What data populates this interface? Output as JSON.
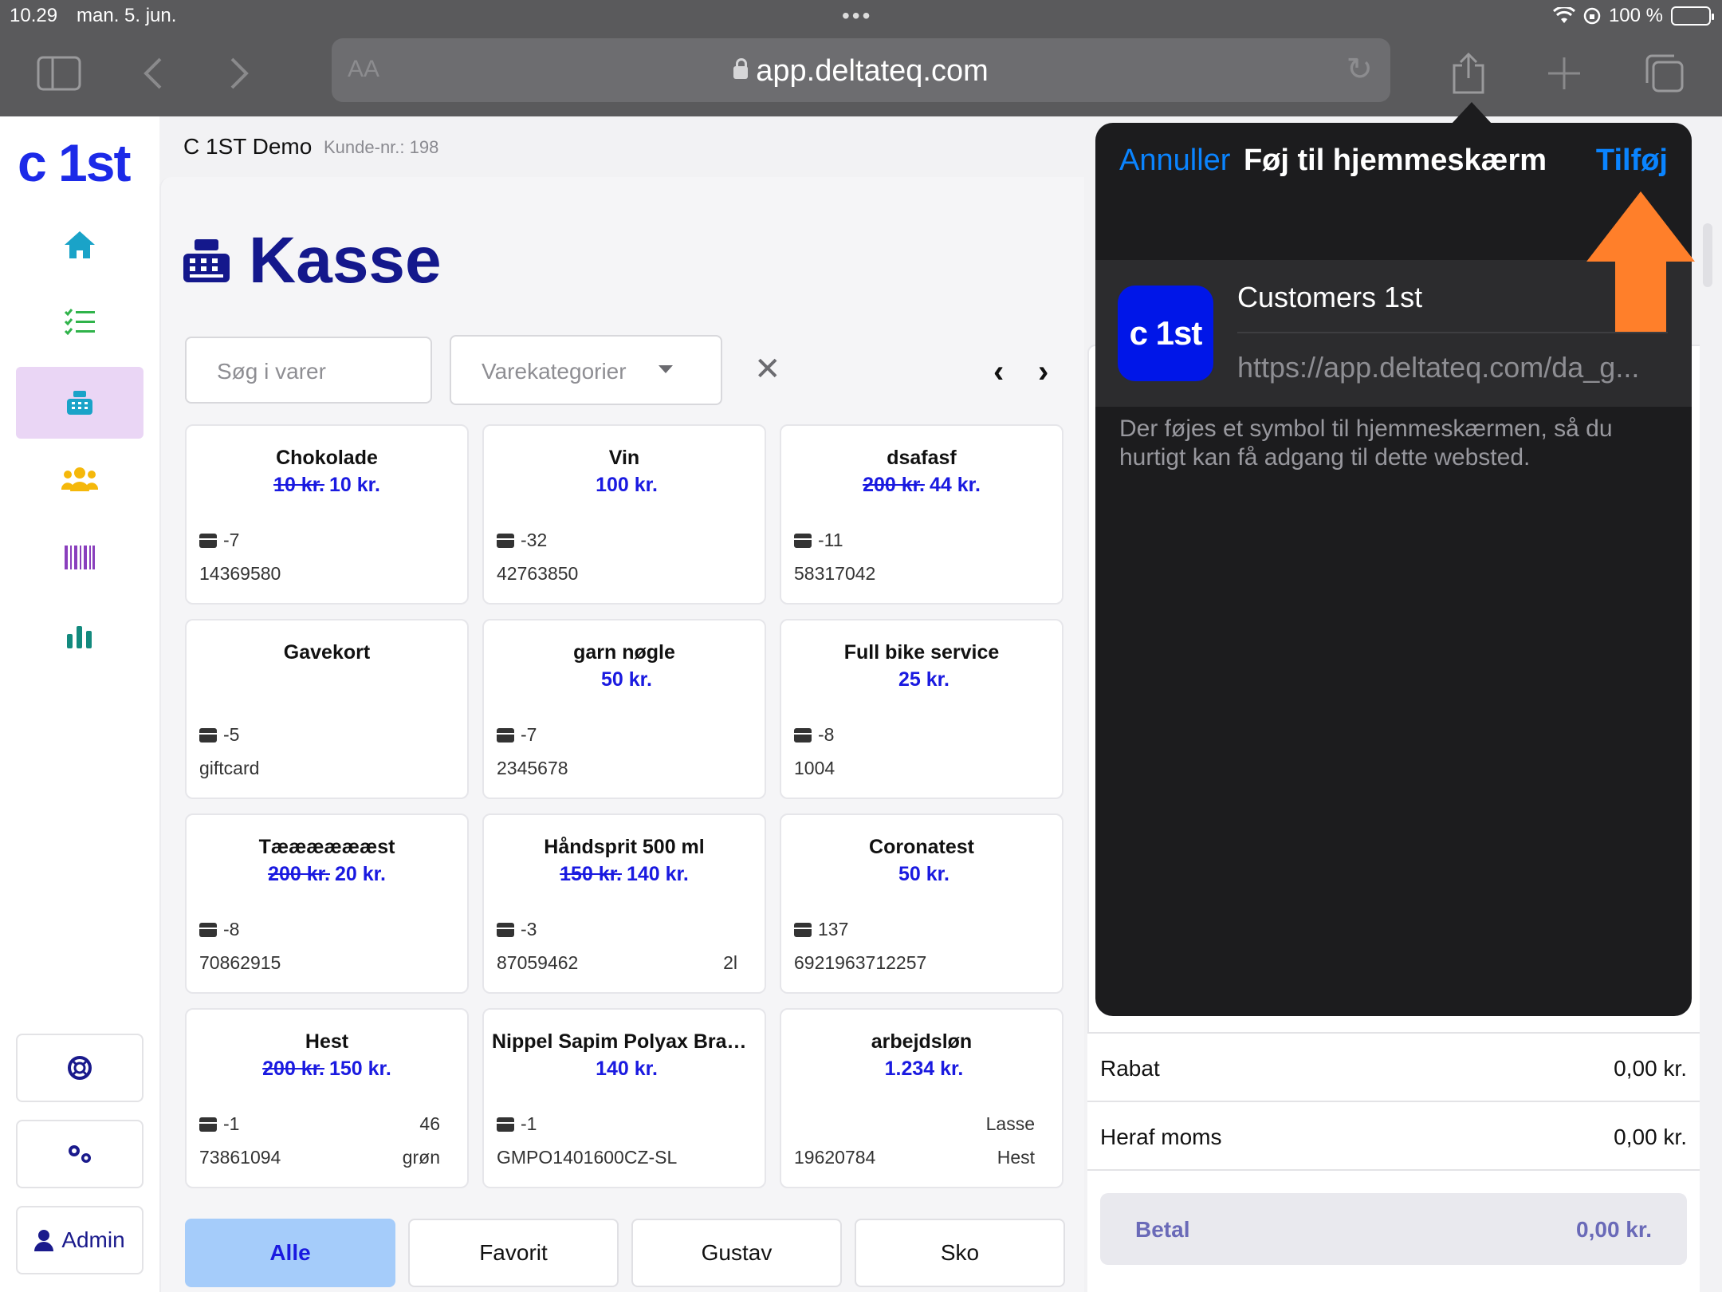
{
  "status": {
    "time": "10.29",
    "date": "man. 5. jun.",
    "battery": "100 %"
  },
  "browser": {
    "url": "app.deltateq.com",
    "aa_label": "AA"
  },
  "app": {
    "logo": "c 1st",
    "company": "C 1ST Demo",
    "customer_no": "Kunde-nr.: 198",
    "nav": [
      "home-icon",
      "checklist-icon",
      "register-icon",
      "users-icon",
      "barcode-icon",
      "chart-icon"
    ],
    "admin_label": "Admin"
  },
  "page": {
    "title": "Kasse",
    "search_placeholder": "Søg i varer",
    "category_placeholder": "Varekategorier"
  },
  "products": [
    {
      "name": "Chokolade",
      "old_price": "10 kr.",
      "price": "10 kr.",
      "stock": "-7",
      "sku": "14369580",
      "extra1": "",
      "extra2": ""
    },
    {
      "name": "Vin",
      "old_price": "",
      "price": "100 kr.",
      "stock": "-32",
      "sku": "42763850",
      "extra1": "",
      "extra2": ""
    },
    {
      "name": "dsafasf",
      "old_price": "200 kr.",
      "price": "44 kr.",
      "stock": "-11",
      "sku": "58317042",
      "extra1": "",
      "extra2": ""
    },
    {
      "name": "Gavekort",
      "old_price": "",
      "price": "",
      "stock": "-5",
      "sku": "giftcard",
      "extra1": "",
      "extra2": ""
    },
    {
      "name": "garn nøgle",
      "old_price": "",
      "price": "50 kr.",
      "stock": "-7",
      "sku": "2345678",
      "extra1": "",
      "extra2": ""
    },
    {
      "name": "Full bike service",
      "old_price": "",
      "price": "25 kr.",
      "stock": "-8",
      "sku": "1004",
      "extra1": "",
      "extra2": ""
    },
    {
      "name": "Tææææææst",
      "old_price": "200 kr.",
      "price": "20 kr.",
      "stock": "-8",
      "sku": "70862915",
      "extra1": "",
      "extra2": ""
    },
    {
      "name": "Håndsprit 500 ml",
      "old_price": "150 kr.",
      "price": "140 kr.",
      "stock": "-3",
      "sku": "87059462",
      "extra1": "",
      "extra2": "2l"
    },
    {
      "name": "Coronatest",
      "old_price": "",
      "price": "50 kr.",
      "stock": "137",
      "sku": "6921963712257",
      "extra1": "",
      "extra2": ""
    },
    {
      "name": "Hest",
      "old_price": "200 kr.",
      "price": "150 kr.",
      "stock": "-1",
      "sku": "73861094",
      "extra1": "46",
      "extra2": "grøn"
    },
    {
      "name": "Nippel Sapim Polyax Brass...",
      "old_price": "",
      "price": "140 kr.",
      "stock": "-1",
      "sku": "GMPO1401600CZ-SL",
      "extra1": "",
      "extra2": ""
    },
    {
      "name": "arbejdsløn",
      "old_price": "",
      "price": "1.234 kr.",
      "stock": "",
      "sku": "19620784",
      "extra1": "Lasse",
      "extra2": "Hest"
    }
  ],
  "tabs": [
    "Alle",
    "Favorit",
    "Gustav",
    "Sko"
  ],
  "cart": {
    "discount_label": "Rabat",
    "discount_value": "0,00 kr.",
    "vat_label": "Heraf moms",
    "vat_value": "0,00 kr.",
    "pay_label": "Betal",
    "pay_value": "0,00 kr."
  },
  "share_sheet": {
    "cancel": "Annuller",
    "title": "Føj til hjemmeskærm",
    "add": "Tilføj",
    "app_icon_text": "c 1st",
    "app_name": "Customers 1st",
    "app_url": "https://app.deltateq.com/da_g...",
    "description": "Der føjes et symbol til hjemmeskærmen, så du hurtigt kan få adgang til dette websted."
  },
  "colors": {
    "brand_blue": "#1c2ae8",
    "ios_blue": "#0a84ff",
    "annotation_arrow": "#ff7f2a"
  }
}
